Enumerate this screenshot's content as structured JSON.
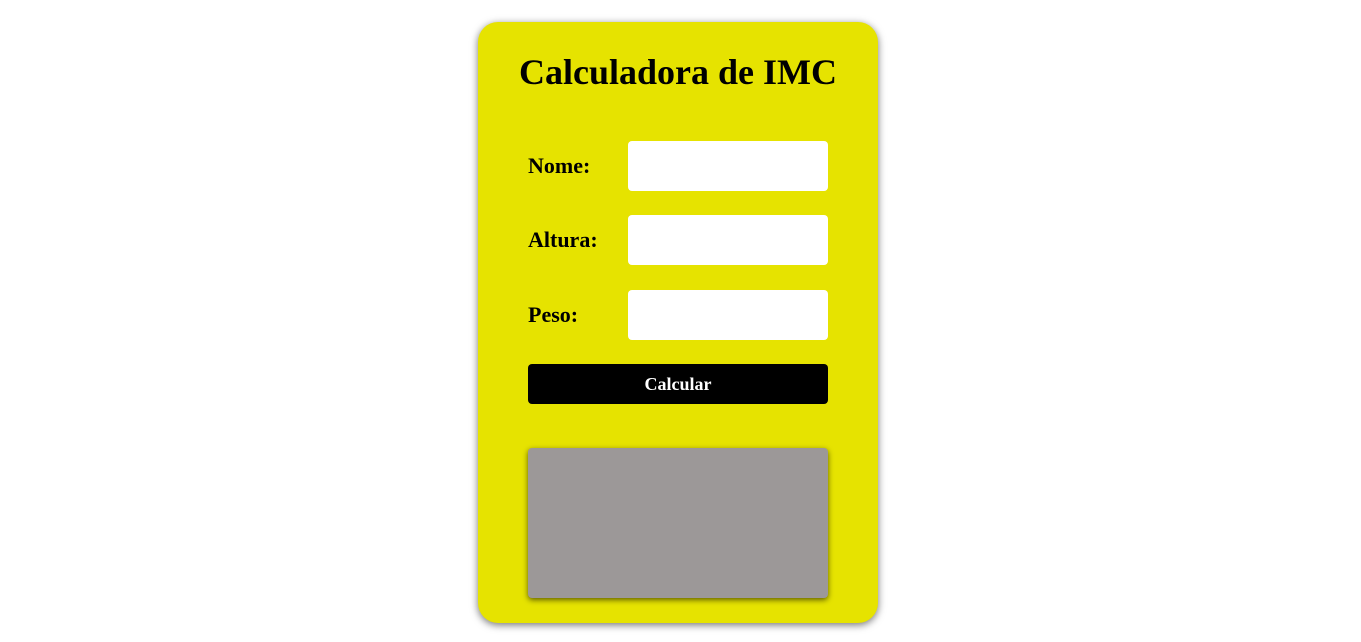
{
  "calculator": {
    "title": "Calculadora de IMC",
    "fields": {
      "nome": {
        "label": "Nome:",
        "value": "",
        "placeholder": ""
      },
      "altura": {
        "label": "Altura:",
        "value": "",
        "placeholder": ""
      },
      "peso": {
        "label": "Peso:",
        "value": "",
        "placeholder": ""
      }
    },
    "button_label": "Calcular",
    "result_text": ""
  },
  "colors": {
    "card_background": "#e6e300",
    "button_background": "#000000",
    "button_text": "#ffffff",
    "result_background": "#9c9898"
  }
}
